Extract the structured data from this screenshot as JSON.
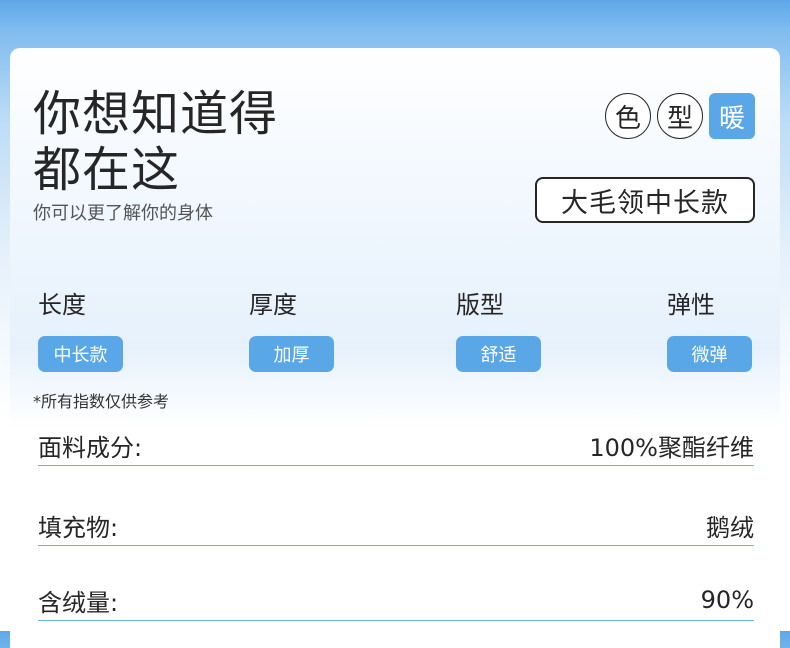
{
  "header": {
    "title_line1": "你想知道得",
    "title_line2": "都在这",
    "subtitle": "你可以更了解你的身体"
  },
  "tags": [
    {
      "label": "色",
      "active": false
    },
    {
      "label": "型",
      "active": false
    },
    {
      "label": "暖",
      "active": true
    }
  ],
  "style_label": "大毛领中长款",
  "attributes": [
    {
      "label": "长度",
      "value": "中长款"
    },
    {
      "label": "厚度",
      "value": "加厚"
    },
    {
      "label": "版型",
      "value": "舒适"
    },
    {
      "label": "弹性",
      "value": "微弹"
    }
  ],
  "disclaimer": "*所有指数仅供参考",
  "specs": [
    {
      "label": "面料成分:",
      "value": "100%聚酯纤维"
    },
    {
      "label": "填充物:",
      "value": "鹅绒"
    },
    {
      "label": "含绒量:",
      "value": "90%"
    }
  ],
  "colors": {
    "accent": "#5aa7e8",
    "text": "#262626",
    "divider": "#6aaee0"
  }
}
